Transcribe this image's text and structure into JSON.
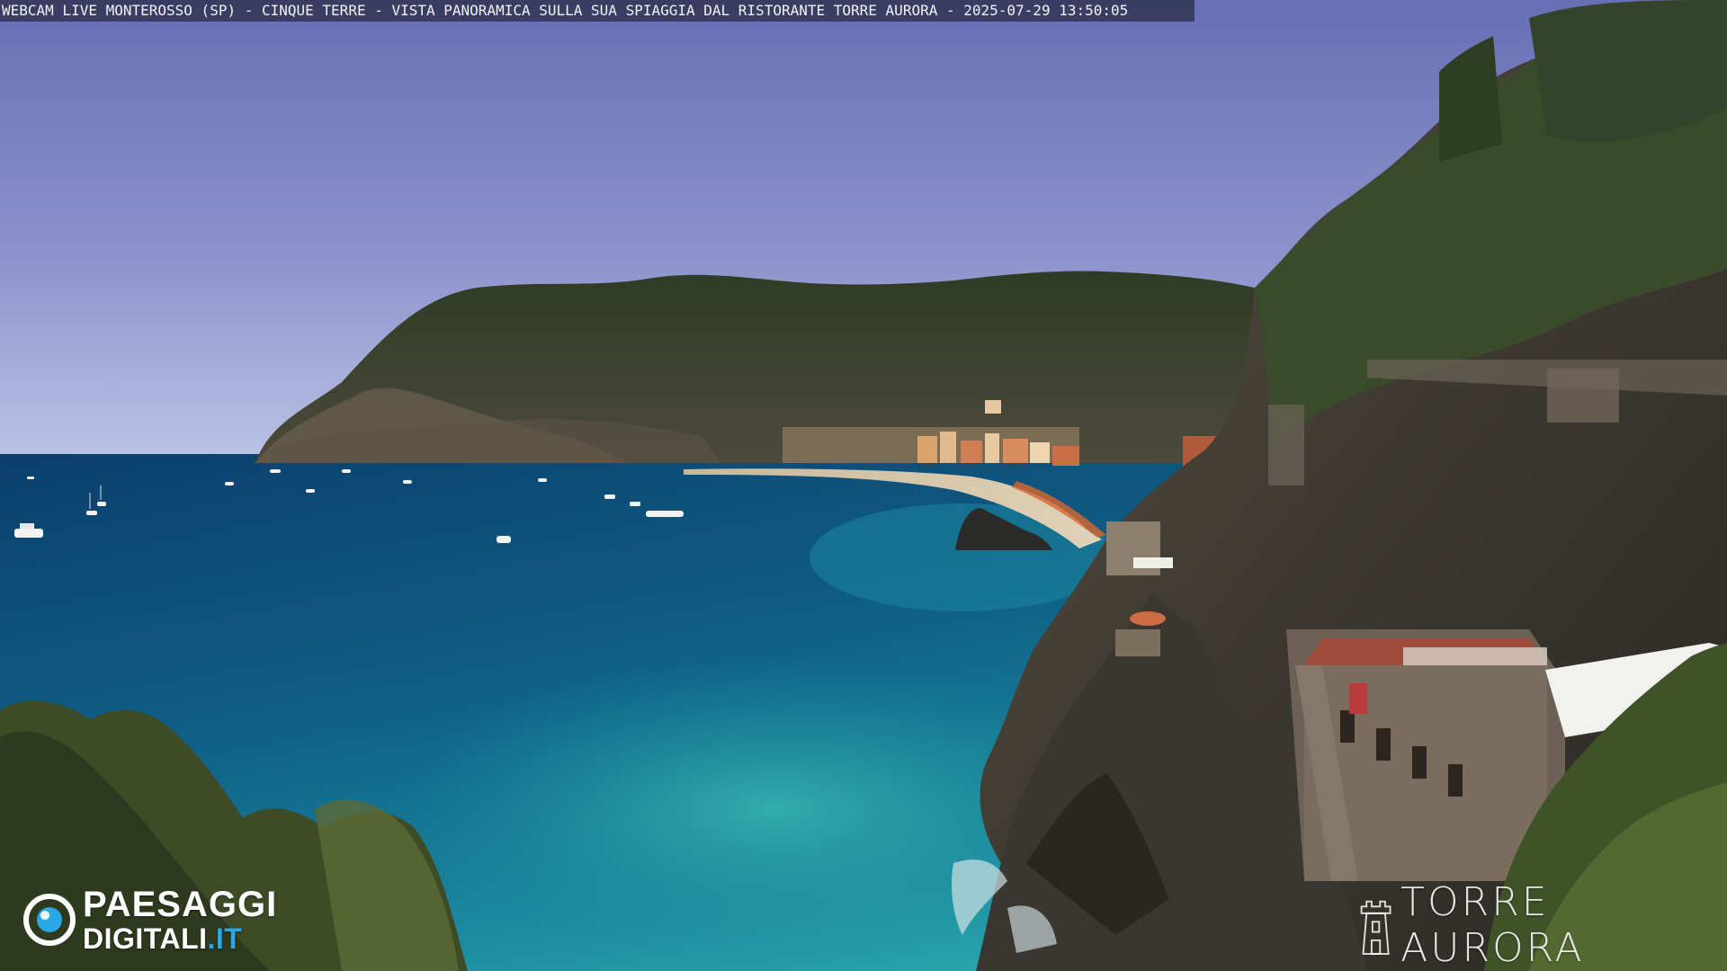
{
  "overlay": {
    "caption": "WEBCAM LIVE MONTEROSSO (SP) - CINQUE TERRE - VISTA PANORAMICA SULLA SUA SPIAGGIA DAL RISTORANTE TORRE AURORA - 2025-07-29 13:50:05"
  },
  "watermarks": {
    "logo_line1": "PAESAGGI",
    "logo_line2_main": "DIGITALI",
    "logo_line2_suffix": ".IT",
    "restaurant_name": "TORRE AURORA"
  },
  "colors": {
    "sky_top": "#6f76b8",
    "sky_horizon": "#b7c0e6",
    "sea_deep": "#0f4f78",
    "sea_shallow": "#1f8fa4",
    "hill_green": "#3d4a2e",
    "rock": "#4a4640",
    "logo_accent": "#2aa7e4"
  },
  "icons": {
    "logo": "paesaggi-digitali-eye-logo",
    "tower": "torre-aurora-tower-icon"
  }
}
